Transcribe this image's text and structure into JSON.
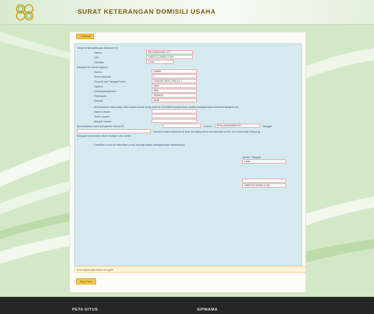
{
  "header": {
    "title": "SURAT KETERANGAN DOMISILI USAHA"
  },
  "toolbar": {
    "back_label": "« Kembali",
    "submit_label": "Buat Surat"
  },
  "form": {
    "signer_intro": "Yang bertandatangan dibawah ini :",
    "signer": [
      {
        "label": "Nama",
        "value": "EKA WAHDIANI, S.Pi"
      },
      {
        "label": "NIP",
        "value": "19820712 200604 2 009"
      },
      {
        "label": "Jabatan",
        "value": "Lurah"
      }
    ],
    "subject_intro": "Dengan ini menerangkan :",
    "subject": [
      {
        "label": "Nama",
        "value": "HAMBI"
      },
      {
        "label": "Jenis Kelamin",
        "value": "L"
      },
      {
        "label": "Tempat dan Tanggal Lahir",
        "value": "GUNUNG BATU 1951-01-1"
      },
      {
        "label": "Agama",
        "value": "islam"
      },
      {
        "label": "Kewarganegaraan",
        "value": "WNI"
      },
      {
        "label": "Pekerjaan",
        "value": "SWASTA"
      },
      {
        "label": "Alamat",
        "value": "jambi"
      }
    ],
    "business_intro": "Berdasarkan data yang ada bahwa benar yang saat ini memiliki/menjalankan usaha sebagaimana tersebut dibawah ini:",
    "business": [
      {
        "label": "Nama Usaha",
        "value": ""
      },
      {
        "label": "Jenis Usaha",
        "value": ""
      },
      {
        "label": "Alamat Usaha",
        "value": ""
      }
    ],
    "rt_prefix": "Berdasarkan surat pengantar ketua RT",
    "rt_value": "",
    "nomor_label": "Nomor",
    "nomor_value": "PROL/00/03/2/MM/2017",
    "tanggal_label": "Tanggal",
    "rt_extra_value": "",
    "rt_suffix": "bahwa Usaha tersebut di atas memang benar berdomisili di RT. 019 Kelurahan Mayang",
    "district_line": "Mangasi kecamatan Alam Barajo kota Jambi.",
    "closing": "Demikian surat ini diberikan untuk dipergunakan sebagaimana semestinya.",
    "sign_place_label": "Jambi, Tanggal",
    "sign_role_value": "Lurah",
    "sign_name_value": "",
    "sign_nip_value": "19820712 200604 2 009"
  },
  "note": "Kosongkan jika tidak mengerti",
  "footer": {
    "left": "PETA SITUS",
    "right": "SIPMAMA"
  },
  "colors": {
    "accent": "#f3c84a",
    "panel": "#d6e9ef",
    "field_border": "#e2aaaa",
    "footer": "#262626"
  },
  "icons": {
    "logo": "clover-logo"
  }
}
